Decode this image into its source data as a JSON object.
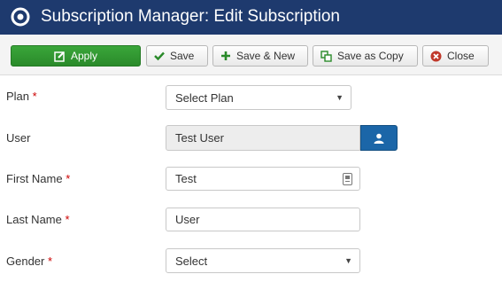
{
  "header": {
    "title": "Subscription Manager: Edit Subscription",
    "logo_icon": "joomla-logo-icon"
  },
  "toolbar": {
    "apply_label": "Apply",
    "save_label": "Save",
    "save_new_label": "Save & New",
    "save_copy_label": "Save as Copy",
    "close_label": "Close"
  },
  "form": {
    "plan": {
      "label": "Plan",
      "required": "*",
      "value": "Select Plan"
    },
    "user": {
      "label": "User",
      "value": "Test User"
    },
    "first_name": {
      "label": "First Name",
      "required": "*",
      "value": "Test"
    },
    "last_name": {
      "label": "Last Name",
      "required": "*",
      "value": "User"
    },
    "gender": {
      "label": "Gender",
      "required": "*",
      "value": "Select"
    }
  },
  "colors": {
    "header_bg": "#1e3a6e",
    "apply_green": "#2f962f",
    "user_button_blue": "#1b66a8",
    "required_red": "#cc0000"
  }
}
